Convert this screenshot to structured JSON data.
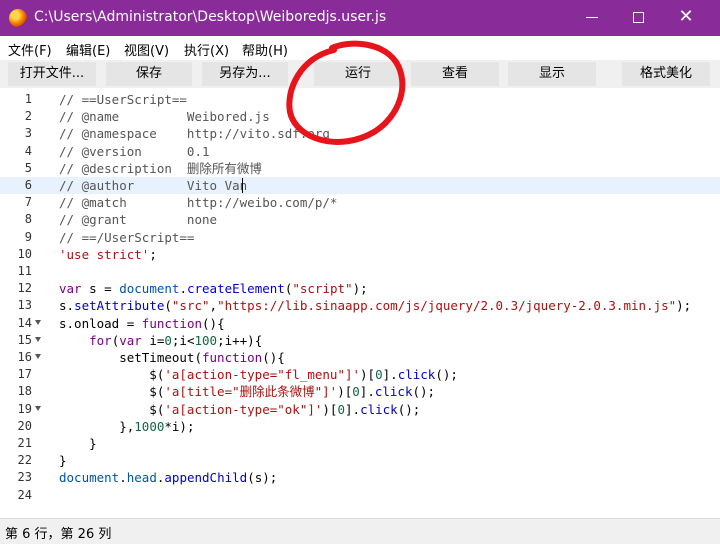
{
  "window": {
    "title": "C:\\Users\\Administrator\\Desktop\\Weiboredjs.user.js",
    "minimize_glyph": "minimize-icon",
    "maximize_glyph": "maximize-icon",
    "close_glyph": "✕"
  },
  "menu": {
    "items": [
      "文件(F)",
      "编辑(E)",
      "视图(V)",
      "执行(X)",
      "帮助(H)"
    ]
  },
  "toolbar": {
    "buttons": [
      "打开文件...",
      "保存",
      "另存为...",
      "运行",
      "查看",
      "显示",
      "格式美化"
    ]
  },
  "editor": {
    "highlighted_line": 6,
    "lines": [
      "// ==UserScript==",
      "// @name         Weibored.js",
      "// @namespace    http://vito.sdf.org",
      "// @version      0.1",
      "// @description  删除所有微博",
      "// @author       Vito Van",
      "// @match        http://weibo.com/p/*",
      "// @grant        none",
      "// ==/UserScript==",
      "'use strict';",
      "",
      "var s = document.createElement(\"script\");",
      "s.setAttribute(\"src\",\"https://lib.sinaapp.com/js/jquery/2.0.3/jquery-2.0.3.min.js\");",
      "s.onload = function(){",
      "    for(var i=0;i<100;i++){",
      "        setTimeout(function(){",
      "            $('a[action-type=\"fl_menu\"]')[0].click();",
      "            $('a[title=\"删除此条微博\"]')[0].click();",
      "            $('a[action-type=\"ok\"]')[0].click();",
      "        },1000*i);",
      "    }",
      "}",
      "document.head.appendChild(s);",
      ""
    ],
    "fold_lines": [
      14,
      15,
      16,
      19
    ]
  },
  "status": {
    "text": "第 6 行，第 26 列"
  },
  "colors": {
    "titlebar": "#8a2b9a",
    "annotation": "#e8141b",
    "highlight": "#e8f2fe"
  }
}
